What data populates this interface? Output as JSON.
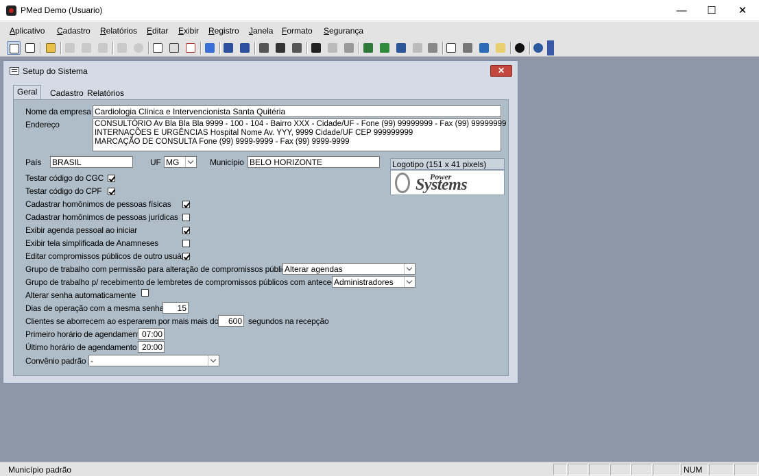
{
  "window": {
    "title": "PMed Demo (Usuario)",
    "minimize": "—",
    "maximize": "☐",
    "close": "✕"
  },
  "menu": [
    "Aplicativo",
    "Cadastro",
    "Relatórios",
    "Editar",
    "Exibir",
    "Registro",
    "Janela",
    "Formato",
    "Segurança"
  ],
  "toolbar": {
    "icons": [
      "form-view-icon",
      "grid-view-icon",
      "open-folder-icon",
      "cut-icon",
      "copy-icon",
      "paste-icon",
      "delete-record-icon",
      "attach-icon",
      "print-preview-icon",
      "print-icon",
      "report-icon",
      "spell-check-icon",
      "sort-ascending-icon",
      "sort-descending-icon",
      "filter-by-selection-icon",
      "filter-icon",
      "advanced-filter-icon",
      "find-icon",
      "find-next-icon",
      "replace-icon",
      "export-icon",
      "excel-icon",
      "word-icon",
      "mail-icon",
      "merge-icon",
      "book-icon",
      "calculator-icon",
      "run-icon",
      "note-icon",
      "help-icon",
      "undo-icon"
    ]
  },
  "dialog": {
    "title": "Setup do Sistema",
    "close_label": "✕",
    "tabs": [
      "Geral",
      "Cadastro",
      "Relatórios"
    ],
    "fields": {
      "empresa_label": "Nome da empresa",
      "empresa_value": "Cardiologia Clínica e Intervencionista Santa Quitéria",
      "endereco_label": "Endereço",
      "endereco_lines": [
        "CONSULTÓRIO  Av Bla Bla Bla 9999 - 100 - 104 - Bairro XXX - Cidade/UF - Fone (99) 99999999 - Fax (99) 99999999",
        "INTERNAÇÕES E URGÊNCIAS  Hospital Nome Av. YYY, 9999 Cidade/UF CEP 999999999",
        "MARCAÇÃO DE CONSULTA  Fone (99) 9999-9999 - Fax (99) 9999-9999"
      ],
      "pais_label": "País",
      "pais_value": "BRASIL",
      "uf_label": "UF",
      "uf_value": "MG",
      "municipio_label": "Município",
      "municipio_value": "BELO HORIZONTE",
      "logotipo_label": "Logotipo (151 x 41 pixels)",
      "logo_text_power": "Power",
      "logo_text_systems": "Systems"
    },
    "checks": [
      {
        "label": "Testar código do CGC",
        "checked": true
      },
      {
        "label": "Testar código do CPF",
        "checked": true
      },
      {
        "label": "Cadastrar homônimos de pessoas físicas",
        "checked": true
      },
      {
        "label": "Cadastrar homônimos de pessoas jurídicas",
        "checked": false
      },
      {
        "label": "Exibir agenda pessoal ao iniciar",
        "checked": true
      },
      {
        "label": "Exibir tela simplificada de Anamneses",
        "checked": false
      },
      {
        "label": "Editar compromissos públicos de outro usuário",
        "checked": true
      }
    ],
    "grupo_alteracao_label": "Grupo de trabalho com permissão para alteração de compromissos públicos",
    "grupo_alteracao_value": "Alterar agendas",
    "grupo_lembretes_label": "Grupo de trabalho p/ recebimento de lembretes de compromissos públicos com antecedência",
    "grupo_lembretes_value": "Administradores",
    "alterar_senha_label": "Alterar senha automaticamente",
    "alterar_senha_checked": false,
    "dias_label": "Dias de operação com a mesma senha",
    "dias_value": "15",
    "clientes_label": "Clientes se aborrecem ao esperarem por mais mais do que",
    "clientes_value": "600",
    "clientes_suffix": "segundos na recepção",
    "primeiro_label": "Primeiro horário de agendamento",
    "primeiro_value": "07:00",
    "ultimo_label": "Último horário de agendamento",
    "ultimo_value": "20:00",
    "convenio_label": "Convênio padrão",
    "convenio_value": "-"
  },
  "status": {
    "text": "Município padrão",
    "num": "NUM"
  }
}
